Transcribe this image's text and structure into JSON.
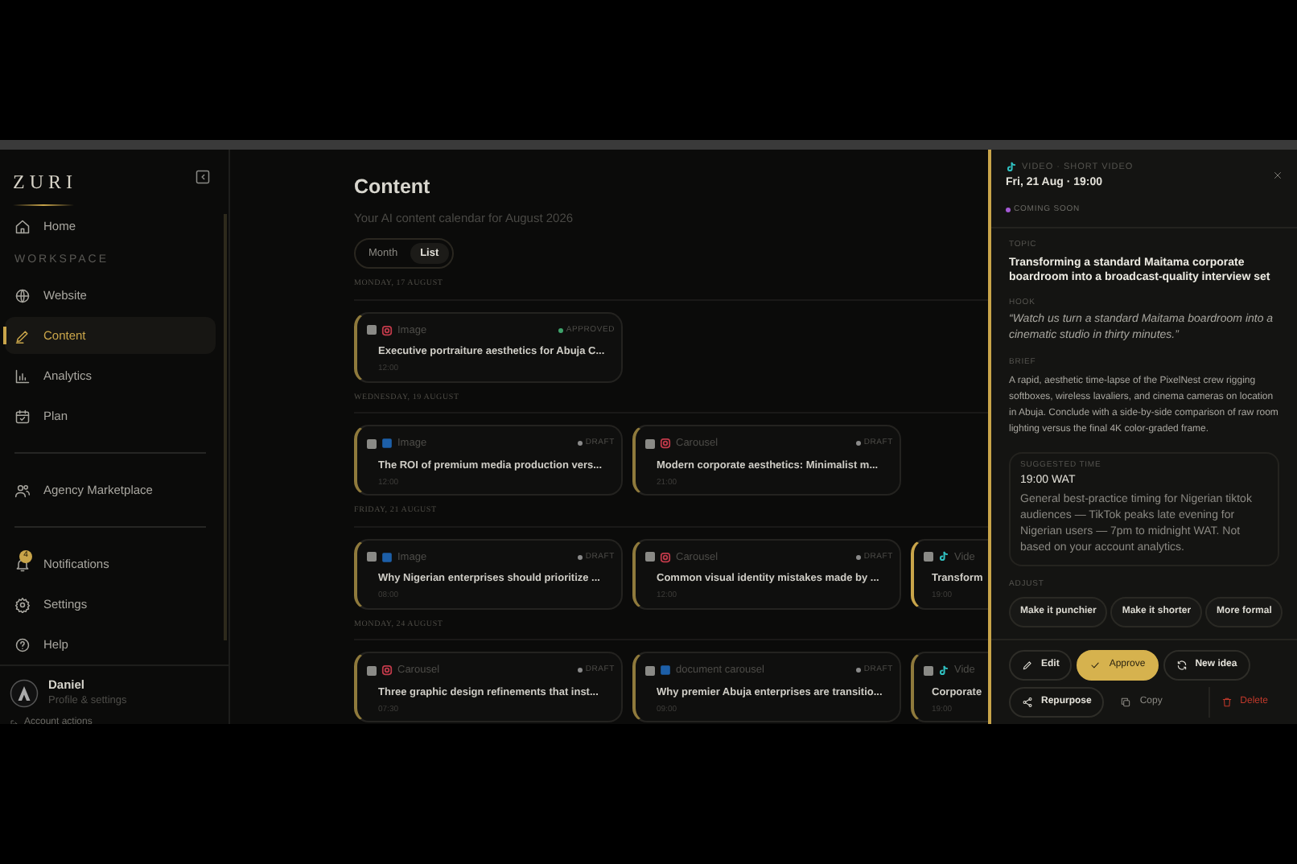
{
  "sidebar": {
    "logo": "ZURI",
    "nav": [
      {
        "kind": "link",
        "label": "Home",
        "selected": false
      },
      {
        "kind": "heading",
        "label": "WORKSPACE"
      },
      {
        "kind": "link",
        "label": "Website",
        "selected": false
      },
      {
        "kind": "link",
        "label": "Content",
        "selected": true
      },
      {
        "kind": "link",
        "label": "Analytics",
        "selected": false
      },
      {
        "kind": "link",
        "label": "Plan",
        "selected": false
      },
      {
        "kind": "divider"
      },
      {
        "kind": "link",
        "label": "Agency Marketplace",
        "selected": false
      },
      {
        "kind": "divider"
      },
      {
        "kind": "link",
        "label": "Notifications",
        "selected": false,
        "badge": "4"
      },
      {
        "kind": "link",
        "label": "Settings",
        "selected": false
      },
      {
        "kind": "link",
        "label": "Help",
        "selected": false
      }
    ],
    "user": {
      "name": "Daniel",
      "subtitle": "Profile & settings",
      "account_action": "Account actions"
    }
  },
  "main": {
    "title": "Content",
    "subtitle": "Your AI content calendar for August 2026",
    "view_toggle": [
      {
        "label": "Month",
        "selected": false
      },
      {
        "label": "List",
        "selected": true
      }
    ],
    "days": [
      {
        "heading": "MONDAY, 17 AUGUST",
        "posts": [
          {
            "kind": "instagram",
            "type": "Image",
            "status": "APPROVED",
            "color": "#3fa36b",
            "title": "Executive portraiture aesthetics for Abuja C...",
            "time": "12:00",
            "checked": false
          }
        ]
      },
      {
        "heading": "WEDNESDAY, 19 AUGUST",
        "posts": [
          {
            "kind": "linkedin",
            "type": "Image",
            "status": "DRAFT",
            "color": "#8a8a8a",
            "title": "The ROI of premium media production vers...",
            "time": "12:00",
            "checked": false
          },
          {
            "kind": "instagram",
            "type": "Carousel",
            "status": "DRAFT",
            "color": "#8a8a8a",
            "title": "Modern corporate aesthetics: Minimalist m...",
            "time": "21:00",
            "checked": false
          }
        ]
      },
      {
        "heading": "FRIDAY, 21 AUGUST",
        "posts": [
          {
            "kind": "linkedin",
            "type": "Image",
            "status": "DRAFT",
            "color": "#8a8a8a",
            "title": "Why Nigerian enterprises should prioritize ...",
            "time": "08:00",
            "checked": false
          },
          {
            "kind": "instagram",
            "type": "Carousel",
            "status": "DRAFT",
            "color": "#8a8a8a",
            "title": "Common visual identity mistakes made by ...",
            "time": "12:00",
            "checked": false
          },
          {
            "kind": "tiktok",
            "type": "Vide",
            "title": "Transform",
            "time": "19:00",
            "checked": false,
            "selected": true
          }
        ]
      },
      {
        "heading": "MONDAY, 24 AUGUST",
        "posts": [
          {
            "kind": "instagram",
            "type": "Carousel",
            "status": "DRAFT",
            "color": "#8a8a8a",
            "title": "Three graphic design refinements that inst...",
            "time": "07:30",
            "checked": false
          },
          {
            "kind": "linkedin",
            "type": "document carousel",
            "status": "DRAFT",
            "color": "#8a8a8a",
            "title": "Why premier Abuja enterprises are transitio...",
            "time": "09:00",
            "checked": false
          },
          {
            "kind": "tiktok",
            "type": "Vide",
            "title": "Corporate",
            "time": "19:00",
            "checked": false,
            "selected": false
          }
        ]
      }
    ]
  },
  "panel": {
    "kind": "tiktok",
    "category": "VIDEO · SHORT VIDEO",
    "datetime": "Fri, 21 Aug · 19:00",
    "status": "COMING SOON",
    "color": "#a45ad6",
    "topic": {
      "label": "TOPIC",
      "text": "Transforming a standard Maitama corporate boardroom into a broadcast-quality interview set"
    },
    "hook": {
      "label": "HOOK",
      "text": "“Watch us turn a standard Maitama boardroom into a cinematic studio in thirty minutes.”"
    },
    "brief": {
      "label": "BRIEF",
      "text": "A rapid, aesthetic time-lapse of the PixelNest crew rigging softboxes, wireless lavaliers, and cinema cameras on location in Abuja. Conclude with a side-by-side comparison of raw room lighting versus the final 4K color-graded frame."
    },
    "suggested_time": {
      "label": "SUGGESTED TIME",
      "time": "19:00 WAT",
      "note": "General best-practice timing for Nigerian tiktok audiences — TikTok peaks late evening for Nigerian users — 7pm to midnight WAT. Not based on your account analytics."
    },
    "adjust": {
      "label": "ADJUST",
      "options": [
        "Make it punchier",
        "Make it shorter",
        "More formal"
      ]
    },
    "actions": [
      {
        "kind": "outline",
        "label": "Edit"
      },
      {
        "kind": "primary",
        "label": "Approve"
      },
      {
        "kind": "outline",
        "label": "New idea"
      },
      {
        "kind": "outline",
        "label": "Repurpose"
      },
      {
        "kind": "plain",
        "label": "Copy"
      },
      {
        "kind": "danger",
        "label": "Delete"
      }
    ]
  }
}
